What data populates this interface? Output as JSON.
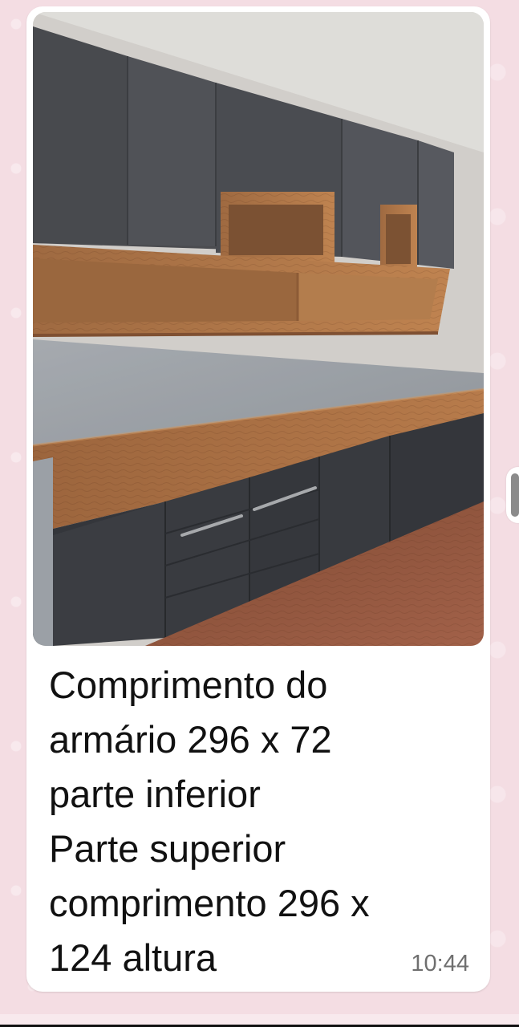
{
  "message": {
    "image": {
      "alt": "Cabinet photo"
    },
    "caption_lines": [
      "Comprimento do",
      "armário 296 x 72",
      "parte inferior",
      "Parte superior",
      "comprimento 296 x",
      "124 altura"
    ],
    "time": "10:44"
  },
  "colors": {
    "chat_background": "#f4dde3",
    "bubble": "#ffffff",
    "text": "#111111",
    "meta": "#6f6f6f"
  }
}
